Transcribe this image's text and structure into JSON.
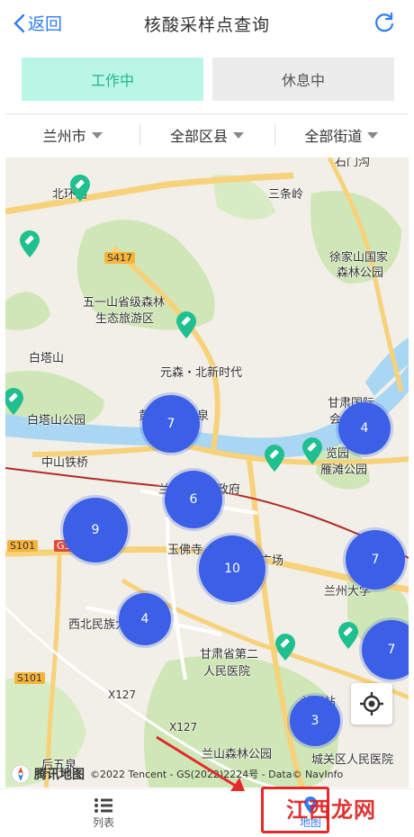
{
  "header": {
    "back_label": "返回",
    "title": "核酸采样点查询"
  },
  "status_tabs": [
    {
      "label": "工作中"
    },
    {
      "label": "休息中"
    }
  ],
  "filters": [
    {
      "label": "兰州市"
    },
    {
      "label": "全部区县"
    },
    {
      "label": "全部街道"
    }
  ],
  "map": {
    "labels": {
      "l1": "北环路",
      "l2": "三条岭",
      "l3": "徐家山国家",
      "l4": "森林公园",
      "l5": "S417",
      "l6": "五一山省级森林",
      "l7": "生态旅游区",
      "l8": "白塔山",
      "l9": "元森・北新时代",
      "l10": "白塔山公园",
      "l11": "黄河音乐喷泉",
      "l12": "甘肃国际",
      "l13": "会展中心",
      "l14": "中山铁桥",
      "l15": "兰州市人民政府",
      "l16": "雁滩公园",
      "l17": "览园",
      "l18": "S101",
      "l19": "G3",
      "l20": "玉佛寺",
      "l21": "东方红广场",
      "l22": "兰州大学",
      "l23": "西北民族大学",
      "l24": "甘肃省第二",
      "l25": "人民医院",
      "l26": "S101",
      "l27": "X127",
      "l28": "X127",
      "l29": "兰州站",
      "l30": "兰山森林公园",
      "l31": "城关区人民医院",
      "l32": "后五泉",
      "l33": "石门沟"
    },
    "clusters": [
      {
        "count": "7"
      },
      {
        "count": "4"
      },
      {
        "count": "6"
      },
      {
        "count": "9"
      },
      {
        "count": "10"
      },
      {
        "count": "7"
      },
      {
        "count": "4"
      },
      {
        "count": "7"
      },
      {
        "count": "3"
      }
    ],
    "attribution_logo": "腾讯地图",
    "attribution_text": "©2022 Tencent - GS(2022)2224号 - Data© NavInfo"
  },
  "bottom_nav": [
    {
      "label": "列表"
    },
    {
      "label": "地图"
    }
  ],
  "watermark": "江西龙网",
  "colors": {
    "accent": "#2f7cf6",
    "active_tab_bg": "#b9f6e6",
    "active_tab_text": "#20b58b",
    "cluster": "#3b5fe6",
    "pin": "#1fbf8f",
    "highlight": "#e32a2a"
  }
}
